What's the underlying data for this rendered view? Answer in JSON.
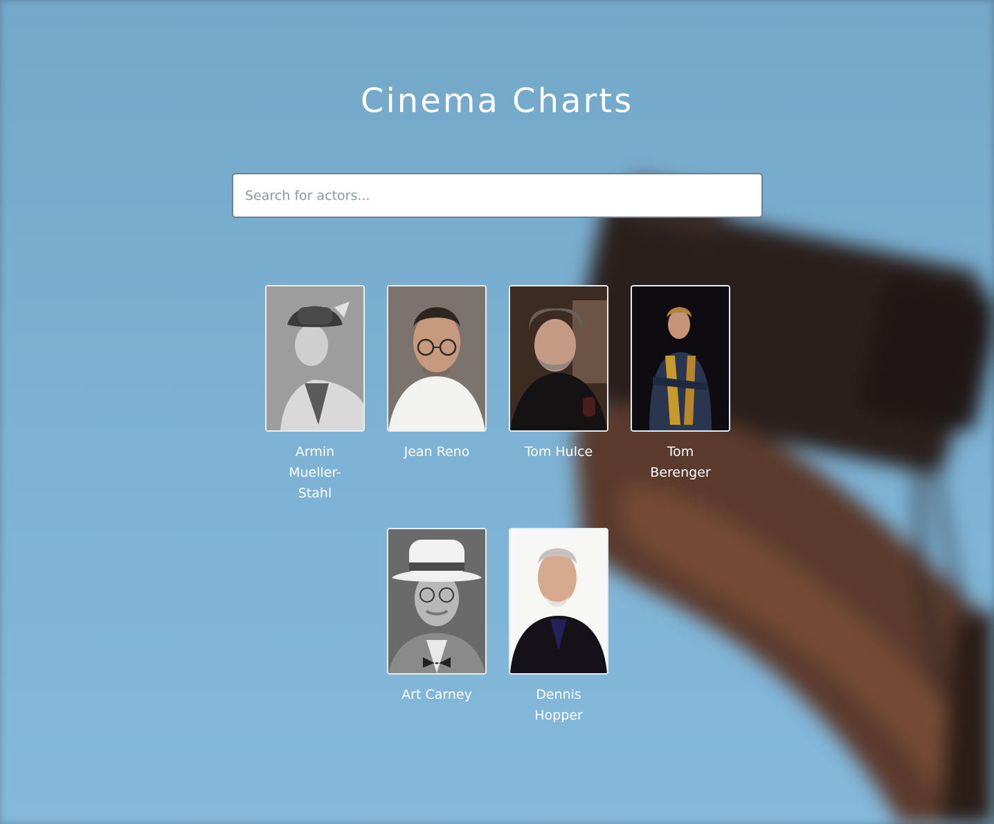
{
  "page": {
    "title": "Cinema Charts"
  },
  "search": {
    "placeholder": "Search for actors...",
    "value": ""
  },
  "actors": [
    {
      "name": "Armin Mueller-Stahl",
      "photo_tone": "grayscale"
    },
    {
      "name": "Jean Reno",
      "photo_tone": "color"
    },
    {
      "name": "Tom Hulce",
      "photo_tone": "color"
    },
    {
      "name": "Tom Berenger",
      "photo_tone": "color"
    },
    {
      "name": "Art Carney",
      "photo_tone": "grayscale"
    },
    {
      "name": "Dennis Hopper",
      "photo_tone": "color"
    }
  ],
  "colors": {
    "background": "#7db2d4",
    "title": "#ffffff",
    "search_border": "#6e7f8f",
    "card_border": "#e8edf1"
  }
}
